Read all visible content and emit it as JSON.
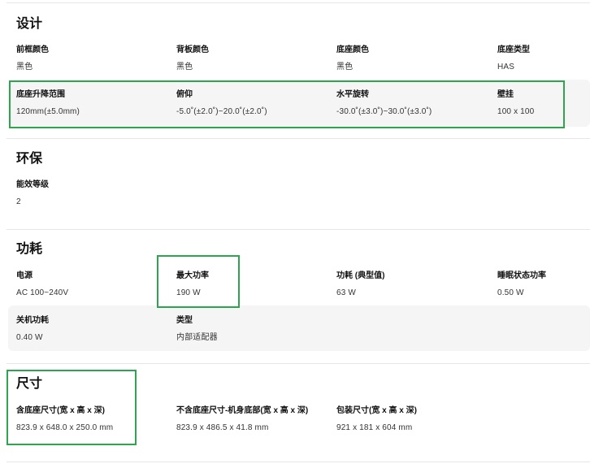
{
  "sections": {
    "design": {
      "title": "设计",
      "specs": [
        {
          "label": "前框颜色",
          "value": "黑色"
        },
        {
          "label": "背板颜色",
          "value": "黑色"
        },
        {
          "label": "底座颜色",
          "value": "黑色"
        },
        {
          "label": "底座类型",
          "value": "HAS"
        },
        {
          "label": "底座升降范围",
          "value": "120mm(±5.0mm)"
        },
        {
          "label": "俯仰",
          "value": "-5.0˚(±2.0˚)~20.0˚(±2.0˚)"
        },
        {
          "label": "水平旋转",
          "value": "-30.0˚(±3.0˚)~30.0˚(±3.0˚)"
        },
        {
          "label": "壁挂",
          "value": "100 x 100"
        }
      ]
    },
    "eco": {
      "title": "环保",
      "specs": [
        {
          "label": "能效等级",
          "value": "2"
        }
      ]
    },
    "power": {
      "title": "功耗",
      "specs": [
        {
          "label": "电源",
          "value": "AC 100~240V"
        },
        {
          "label": "最大功率",
          "value": "190 W"
        },
        {
          "label": "功耗 (典型值)",
          "value": "63 W"
        },
        {
          "label": "睡眠状态功率",
          "value": "0.50 W"
        },
        {
          "label": "关机功耗",
          "value": "0.40 W"
        },
        {
          "label": "类型",
          "value": "内部适配器"
        }
      ]
    },
    "size": {
      "title": "尺寸",
      "specs": [
        {
          "label": "含底座尺寸(宽 x 高 x 深)",
          "value": "823.9 x 648.0 x 250.0 mm"
        },
        {
          "label": "不含底座尺寸-机身底部(宽 x 高 x 深)",
          "value": "823.9 x 486.5 x 41.8 mm"
        },
        {
          "label": "包装尺寸(宽 x 高 x 深)",
          "value": "921 x 181 x 604 mm"
        }
      ]
    }
  },
  "colors": {
    "highlight": "#2fa34f",
    "row_background": "#f5f5f5",
    "divider": "#e6e6e6"
  }
}
